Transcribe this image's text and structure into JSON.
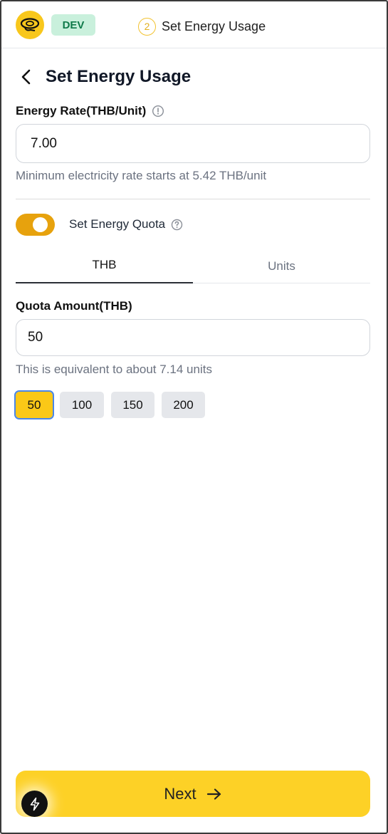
{
  "header": {
    "env_badge": "DEV",
    "step_number": "2",
    "step_label": "Set Energy Usage",
    "logo_icon": "brand-logo-icon",
    "brand_color": "#f8c71c"
  },
  "page": {
    "title": "Set Energy Usage",
    "back_icon": "chevron-left-icon"
  },
  "energy_rate": {
    "label": "Energy Rate(THB/Unit)",
    "value": "7.00",
    "helper": "Minimum electricity rate starts at 5.42 THB/unit",
    "info_icon": "info-icon"
  },
  "quota": {
    "toggle_label": "Set Energy Quota",
    "toggle_on": true,
    "toggle_color": "#e7a20d",
    "help_icon": "question-icon",
    "tabs": [
      {
        "label": "THB",
        "active": true
      },
      {
        "label": "Units",
        "active": false
      }
    ],
    "amount_label": "Quota Amount(THB)",
    "amount_value": "50",
    "helper": "This is equivalent to about 7.14 units",
    "presets": [
      "50",
      "100",
      "150",
      "200"
    ],
    "selected_preset": "50"
  },
  "footer": {
    "next_label": "Next",
    "next_icon": "arrow-right-icon",
    "next_color": "#fdd126",
    "fab_icon": "lightning-icon"
  }
}
